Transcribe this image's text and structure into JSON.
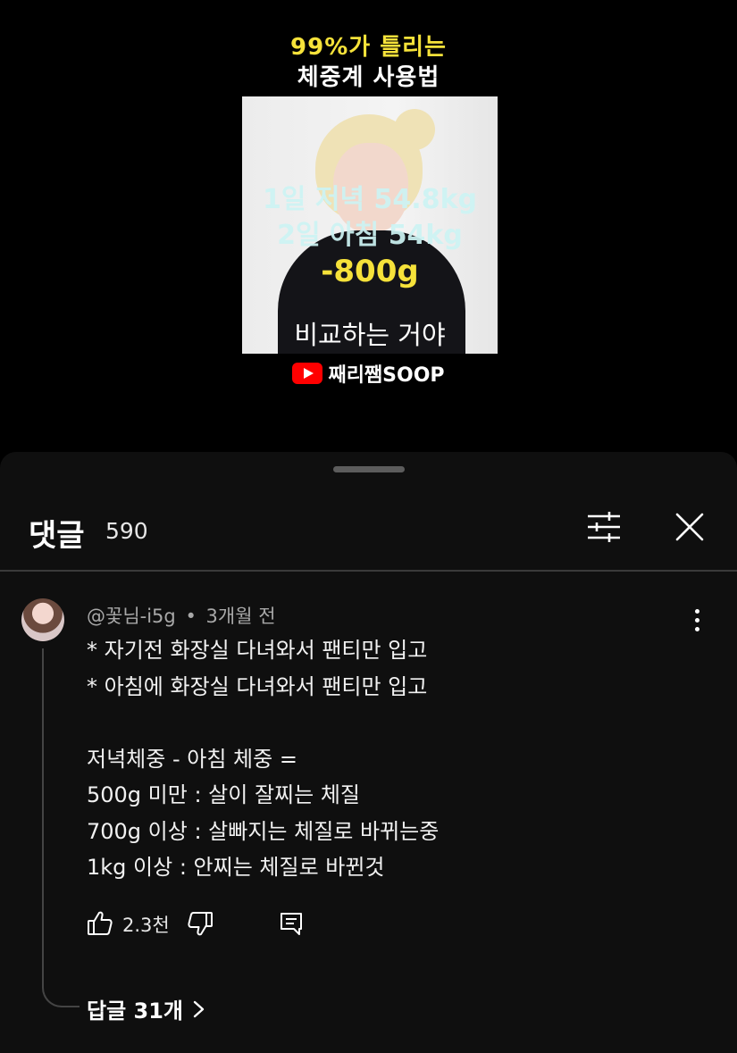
{
  "video": {
    "title_line1": "99%가 틀리는",
    "title_line2": "체중계 사용법",
    "overlay_line1": "1일 저녁 54.8kg",
    "overlay_line2": "2일 아침 54kg",
    "overlay_highlight": "-800g",
    "caption": "비교하는 거야",
    "channel_brand": "째리쨈SOOP"
  },
  "comments_sheet": {
    "title": "댓글",
    "count": "590",
    "icons": {
      "filter": "filter-sliders-icon",
      "close": "close-icon"
    }
  },
  "comment": {
    "author": "@꽃님-i5g",
    "separator": "•",
    "time": "3개월 전",
    "lines": [
      "* 자기전 화장실 다녀와서 팬티만 입고",
      "* 아침에 화장실 다녀와서 팬티만 입고",
      "",
      "저녁체중 - 아침 체중 =",
      "500g 미만 : 살이 잘찌는 체질",
      "700g 이상 :  살빠지는 체질로 바뀌는중",
      "1kg 이상 : 안찌는 체질로 바뀐것"
    ],
    "like_count": "2.3천",
    "replies_label": "답글 31개",
    "icons": {
      "like": "thumbs-up-icon",
      "dislike": "thumbs-down-icon",
      "reply": "reply-icon",
      "more": "more-vertical-icon",
      "chevron": "chevron-right-icon"
    }
  },
  "colors": {
    "title_yellow": "#f6e23a",
    "overlay_cyan": "#cdf4f4",
    "sheet_bg": "#0f0f0f",
    "yt_red": "#ff0000"
  }
}
